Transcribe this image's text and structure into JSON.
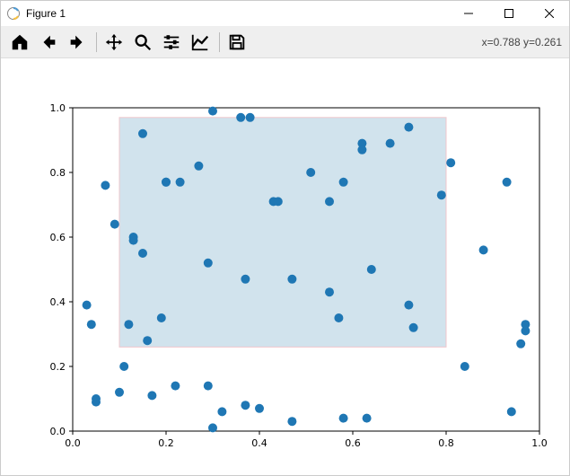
{
  "window": {
    "title": "Figure 1"
  },
  "toolbar": {
    "coords": "x=0.788 y=0.261"
  },
  "chart_data": {
    "type": "scatter",
    "xlim": [
      0.0,
      1.0
    ],
    "ylim": [
      0.0,
      1.0
    ],
    "xticks": [
      0.0,
      0.2,
      0.4,
      0.6,
      0.8,
      1.0
    ],
    "yticks": [
      0.0,
      0.2,
      0.4,
      0.6,
      0.8,
      1.0
    ],
    "rectangle": {
      "x0": 0.1,
      "y0": 0.26,
      "x1": 0.8,
      "y1": 0.97,
      "fill": "#b8d4e3",
      "edge": "#f0c7cc"
    },
    "point_color": "#1f77b4",
    "point_radius": 5,
    "x": [
      0.03,
      0.04,
      0.05,
      0.05,
      0.07,
      0.09,
      0.1,
      0.11,
      0.12,
      0.13,
      0.13,
      0.15,
      0.15,
      0.16,
      0.17,
      0.19,
      0.2,
      0.2,
      0.22,
      0.23,
      0.27,
      0.29,
      0.29,
      0.3,
      0.3,
      0.32,
      0.36,
      0.37,
      0.37,
      0.38,
      0.4,
      0.43,
      0.44,
      0.47,
      0.47,
      0.51,
      0.55,
      0.55,
      0.57,
      0.58,
      0.58,
      0.62,
      0.62,
      0.63,
      0.64,
      0.68,
      0.72,
      0.72,
      0.73,
      0.79,
      0.81,
      0.84,
      0.88,
      0.93,
      0.94,
      0.96,
      0.97,
      0.97
    ],
    "y": [
      0.39,
      0.33,
      0.1,
      0.09,
      0.76,
      0.64,
      0.12,
      0.2,
      0.33,
      0.6,
      0.59,
      0.92,
      0.55,
      0.28,
      0.11,
      0.35,
      0.77,
      0.77,
      0.14,
      0.77,
      0.82,
      0.52,
      0.14,
      0.99,
      0.01,
      0.06,
      0.97,
      0.47,
      0.08,
      0.97,
      0.07,
      0.71,
      0.71,
      0.47,
      0.03,
      0.8,
      0.43,
      0.71,
      0.35,
      0.77,
      0.04,
      0.89,
      0.87,
      0.04,
      0.5,
      0.89,
      0.94,
      0.39,
      0.32,
      0.73,
      0.83,
      0.2,
      0.56,
      0.77,
      0.06,
      0.27,
      0.31,
      0.33
    ]
  }
}
